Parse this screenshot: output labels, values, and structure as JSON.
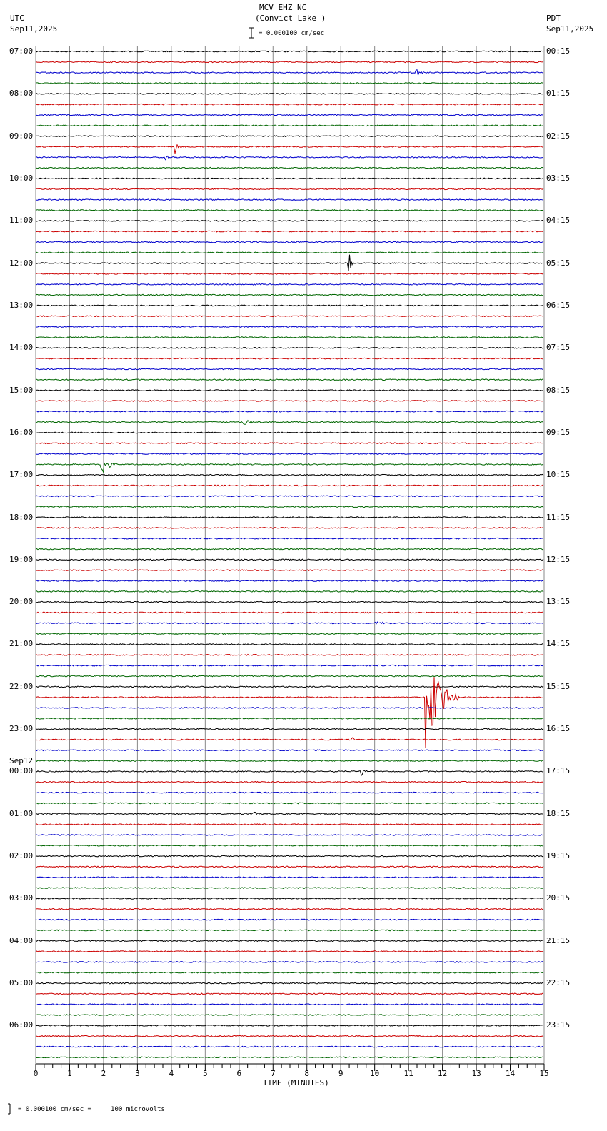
{
  "header": {
    "title": "MCV EHZ NC",
    "subtitle": "(Convict Lake )",
    "left_tz": "UTC",
    "left_date": "Sep11,2025",
    "right_tz": "PDT",
    "right_date": "Sep11,2025",
    "scale": "= 0.000100 cm/sec"
  },
  "footer": {
    "scale": "= 0.000100 cm/sec =     100 microvolts"
  },
  "chart_data": {
    "type": "line",
    "title": "MCV EHZ NC (Convict Lake )",
    "xlabel": "TIME (MINUTES)",
    "xlim": [
      0,
      15
    ],
    "x_ticks": [
      "0",
      "1",
      "2",
      "3",
      "4",
      "5",
      "6",
      "7",
      "8",
      "9",
      "10",
      "11",
      "12",
      "13",
      "14",
      "15"
    ],
    "minutes_per_line": 15,
    "line_count": 96,
    "colors": [
      "#000000",
      "#cc0000",
      "#0000cc",
      "#006600"
    ],
    "left_labels": [
      "07:00",
      "08:00",
      "09:00",
      "10:00",
      "11:00",
      "12:00",
      "13:00",
      "14:00",
      "15:00",
      "16:00",
      "17:00",
      "18:00",
      "19:00",
      "20:00",
      "21:00",
      "22:00",
      "23:00",
      "00:00",
      "01:00",
      "02:00",
      "03:00",
      "04:00",
      "05:00",
      "06:00"
    ],
    "date_change": {
      "label": "Sep12",
      "hour_index": 17
    },
    "right_labels": [
      "00:15",
      "01:15",
      "02:15",
      "03:15",
      "04:15",
      "05:15",
      "06:15",
      "07:15",
      "08:15",
      "09:15",
      "10:15",
      "11:15",
      "12:15",
      "13:15",
      "14:15",
      "15:15",
      "16:15",
      "17:15",
      "18:15",
      "19:15",
      "20:15",
      "21:15",
      "22:15",
      "23:15"
    ],
    "events": [
      {
        "line": 2,
        "minute": 11.2,
        "amp": 6,
        "dur": 0.4
      },
      {
        "line": 9,
        "minute": 4.1,
        "amp": 10,
        "dur": 0.2
      },
      {
        "line": 10,
        "minute": 3.8,
        "amp": 9,
        "dur": 0.2
      },
      {
        "line": 20,
        "minute": 9.2,
        "amp": 30,
        "dur": 0.2
      },
      {
        "line": 35,
        "minute": 6.1,
        "amp": 8,
        "dur": 0.4
      },
      {
        "line": 39,
        "minute": 1.9,
        "amp": 25,
        "dur": 0.5
      },
      {
        "line": 54,
        "minute": 10.0,
        "amp": 3,
        "dur": 0.8
      },
      {
        "line": 61,
        "minute": 11.5,
        "amp": 80,
        "dur": 1.0
      },
      {
        "line": 65,
        "minute": 9.3,
        "amp": 9,
        "dur": 0.2
      },
      {
        "line": 68,
        "minute": 9.6,
        "amp": 7,
        "dur": 0.2
      },
      {
        "line": 72,
        "minute": 6.4,
        "amp": 7,
        "dur": 0.3
      }
    ]
  }
}
